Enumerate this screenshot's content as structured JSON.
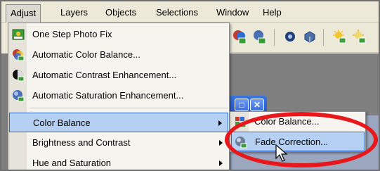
{
  "menubar": {
    "items": [
      {
        "label": "Adjust",
        "active": true
      },
      {
        "label": "Layers"
      },
      {
        "label": "Objects"
      },
      {
        "label": "Selections"
      },
      {
        "label": "Window"
      },
      {
        "label": "Help"
      }
    ]
  },
  "adjust_menu": {
    "items": [
      {
        "label": "One Step Photo Fix",
        "icon": "photo-fix-icon"
      },
      {
        "label": "Automatic Color Balance...",
        "icon": "color-balance-icon"
      },
      {
        "label": "Automatic Contrast Enhancement...",
        "icon": "contrast-icon"
      },
      {
        "label": "Automatic Saturation Enhancement...",
        "icon": "saturation-icon"
      },
      {
        "label": "Color Balance",
        "has_submenu": true,
        "highlighted": true
      },
      {
        "label": "Brightness and Contrast",
        "has_submenu": true
      },
      {
        "label": "Hue and Saturation",
        "has_submenu": true
      }
    ]
  },
  "color_balance_submenu": {
    "items": [
      {
        "label": "Color Balance...",
        "icon": "color-balance-icon"
      },
      {
        "label": "Fade Correction...",
        "icon": "fade-correction-icon",
        "highlighted": true
      }
    ]
  },
  "colors": {
    "highlight": "#b6d0f4",
    "highlight_border": "#3169c6",
    "annotation": "#e8171c",
    "title_bar": "#2454c5"
  }
}
